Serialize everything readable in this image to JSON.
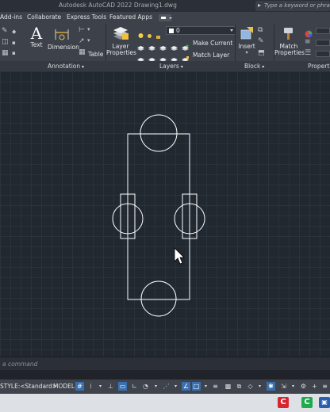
{
  "titlebar": {
    "title": "Autodesk AutoCAD 2022    Drawing1.dwg",
    "search_placeholder": "Type a keyword or phrase"
  },
  "menu": {
    "tabs": [
      "Add-ins",
      "Collaborate",
      "Express Tools",
      "Featured Apps"
    ]
  },
  "ribbon": {
    "annotation": {
      "text_label": "Text",
      "dimension_label": "Dimension",
      "table_label": "Table",
      "group_label": "Annotation"
    },
    "layers": {
      "layer_properties_label": "Layer\nProperties",
      "current_layer": "0",
      "make_current_label": "Make Current",
      "match_layer_label": "Match Layer",
      "group_label": "Layers"
    },
    "block": {
      "insert_label": "Insert",
      "group_label": "Block"
    },
    "properties": {
      "match_properties_label": "Match\nProperties",
      "group_label": "Properties"
    }
  },
  "command_line": {
    "text": "a  command"
  },
  "statusbar": {
    "style_text": "STYLE:<Standard>",
    "model_label": "MODEL"
  },
  "colors": {
    "canvas_bg": "#212830",
    "drawing_stroke": "#ffffff",
    "accent_blue": "#3a6fb0"
  }
}
